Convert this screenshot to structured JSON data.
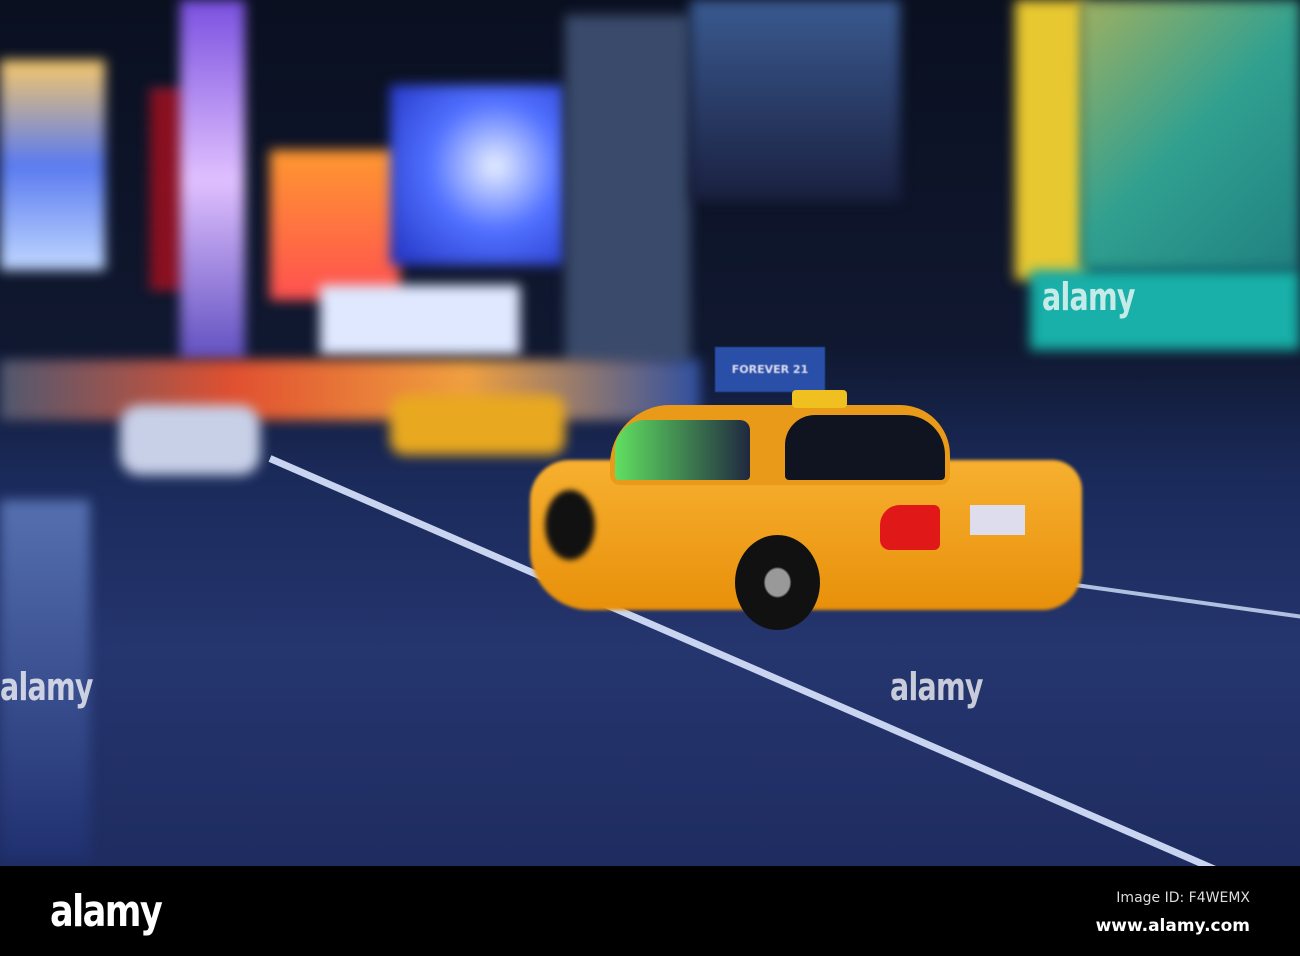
{
  "photo": {
    "subject": "yellow-taxi",
    "taxi_sign": "FOREVER 21"
  },
  "watermark": {
    "text": "alamy"
  },
  "footer": {
    "logo": "alamy",
    "image_id": "Image ID: F4WEMX",
    "url": "www.alamy.com"
  }
}
